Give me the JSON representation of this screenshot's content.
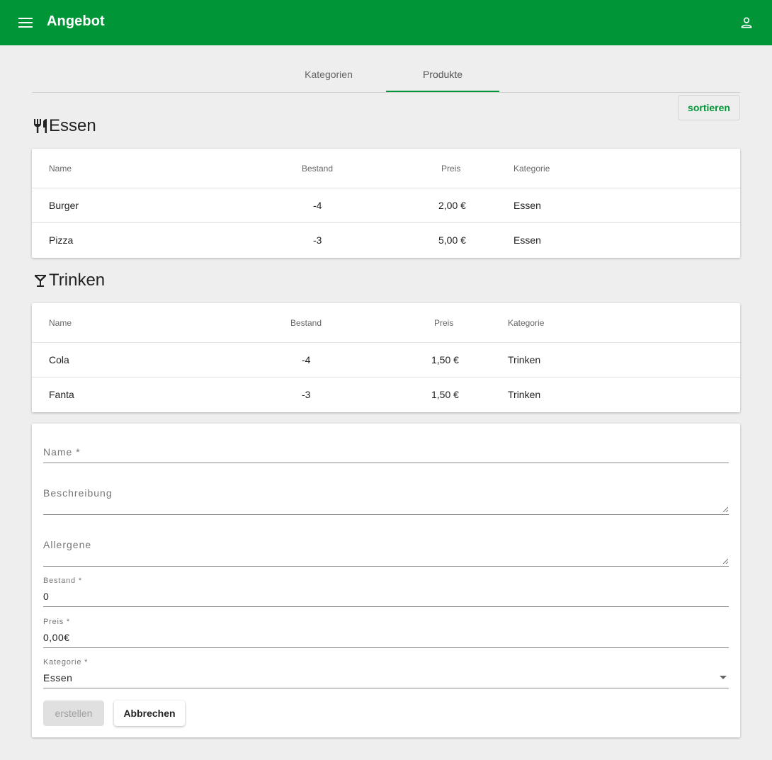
{
  "appbar": {
    "title": "Angebot",
    "menu_icon": "hamburger-menu-icon",
    "account_icon": "account-person-icon",
    "color": "#009638"
  },
  "tabs": [
    {
      "label": "Kategorien",
      "active": false
    },
    {
      "label": "Produkte",
      "active": true
    }
  ],
  "sort_button": {
    "label": "sortieren"
  },
  "sections": {
    "essen": {
      "title": "Essen",
      "icon": "restaurant-fork-knife-icon",
      "columns": [
        "Name",
        "Bestand",
        "Preis",
        "Kategorie"
      ],
      "rows": [
        {
          "name": "Burger",
          "bestand": "-4",
          "preis": "2,00 €",
          "kategorie": "Essen"
        },
        {
          "name": "Pizza",
          "bestand": "-3",
          "preis": "5,00 €",
          "kategorie": "Essen"
        }
      ]
    },
    "trinken": {
      "title": "Trinken",
      "icon": "cocktail-glass-icon",
      "columns": [
        "Name",
        "Bestand",
        "Preis",
        "Kategorie"
      ],
      "rows": [
        {
          "name": "Cola",
          "bestand": "-4",
          "preis": "1,50 €",
          "kategorie": "Trinken"
        },
        {
          "name": "Fanta",
          "bestand": "-3",
          "preis": "1,50 €",
          "kategorie": "Trinken"
        }
      ]
    }
  },
  "form": {
    "name_placeholder": "Name *",
    "beschreibung_placeholder": "Beschreibung",
    "allergene_placeholder": "Allergene",
    "bestand_label": "Bestand *",
    "bestand_value": "0",
    "preis_label": "Preis *",
    "preis_value": "0,00€",
    "kategorie_label": "Kategorie *",
    "kategorie_value": "Essen",
    "create_label": "erstellen",
    "cancel_label": "Abbrechen"
  }
}
